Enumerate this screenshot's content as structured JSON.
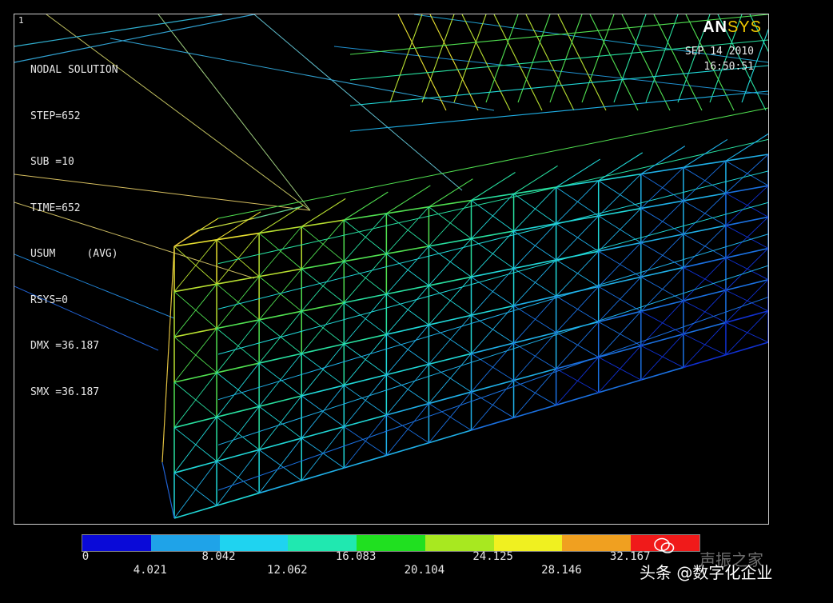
{
  "window": {
    "number": "1"
  },
  "solution": {
    "lines": [
      "NODAL SOLUTION",
      "STEP=652",
      "SUB =10",
      "TIME=652",
      "USUM     (AVG)",
      "RSYS=0",
      "DMX =36.187",
      "SMX =36.187"
    ]
  },
  "brand": {
    "logo_an": "AN",
    "logo_sys": "SYS"
  },
  "timestamp": {
    "date": "SEP 14 2010",
    "time": "16:50:51"
  },
  "legend": {
    "colors": [
      "#0a0ad8",
      "#1fa3e8",
      "#1fd3f0",
      "#20e8b0",
      "#20e020",
      "#a8e820",
      "#f0f020",
      "#f0a020",
      "#f01a1a"
    ],
    "labels_top": [
      "0",
      "8.042",
      "16.083",
      "24.125",
      "32.167"
    ],
    "labels_bottom": [
      "4.021",
      "12.062",
      "20.104",
      "28.146"
    ]
  },
  "watermark": {
    "text": "头条 @数字化企业",
    "faded": "声振之家"
  }
}
